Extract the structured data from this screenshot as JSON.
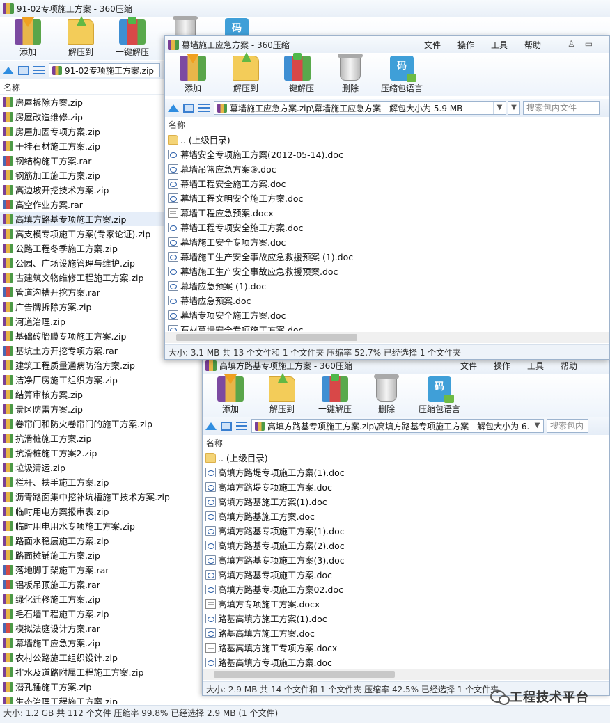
{
  "main": {
    "title": "91-02专项施工方案 - 360压缩",
    "toolbar": [
      "添加",
      "解压到",
      "一键解压"
    ],
    "code_badge": "码",
    "path": "91-02专项施工方案.zip",
    "column_name": "名称",
    "files": [
      {
        "name": "房屋拆除方案.zip",
        "type": "zip"
      },
      {
        "name": "房屋改造维修.zip",
        "type": "zip"
      },
      {
        "name": "房屋加固专项方案.zip",
        "type": "zip"
      },
      {
        "name": "干挂石材施工方案.zip",
        "type": "zip"
      },
      {
        "name": "钢结构施工方案.rar",
        "type": "rar"
      },
      {
        "name": "钢筋加工施工方案.zip",
        "type": "zip"
      },
      {
        "name": "高边坡开挖技术方案.zip",
        "type": "zip"
      },
      {
        "name": "高空作业方案.rar",
        "type": "rar"
      },
      {
        "name": "高填方路基专项施工方案.zip",
        "type": "zip",
        "selected": true
      },
      {
        "name": "高支模专项施工方案(专家论证).zip",
        "type": "zip"
      },
      {
        "name": "公路工程冬季施工方案.zip",
        "type": "zip"
      },
      {
        "name": "公园、广场设施管理与维护.zip",
        "type": "zip"
      },
      {
        "name": "古建筑文物维修工程施工方案.zip",
        "type": "zip"
      },
      {
        "name": "管道沟槽开挖方案.rar",
        "type": "rar"
      },
      {
        "name": "广告牌拆除方案.zip",
        "type": "zip"
      },
      {
        "name": "河道治理.zip",
        "type": "zip"
      },
      {
        "name": "基础砖胎膜专项施工方案.zip",
        "type": "zip"
      },
      {
        "name": "基坑土方开挖专项方案.rar",
        "type": "rar"
      },
      {
        "name": "建筑工程质量通病防治方案.zip",
        "type": "zip"
      },
      {
        "name": "洁净厂房施工组织方案.zip",
        "type": "zip"
      },
      {
        "name": "结算审核方案.zip",
        "type": "zip"
      },
      {
        "name": "景区防雷方案.zip",
        "type": "zip"
      },
      {
        "name": "卷帘门和防火卷帘门的施工方案.zip",
        "type": "zip"
      },
      {
        "name": "抗滑桩施工方案.zip",
        "type": "zip"
      },
      {
        "name": "抗滑桩施工方案2.zip",
        "type": "zip"
      },
      {
        "name": "垃圾清运.zip",
        "type": "zip"
      },
      {
        "name": "栏杆、扶手施工方案.zip",
        "type": "zip"
      },
      {
        "name": "沥青路面集中挖补坑槽施工技术方案.zip",
        "type": "zip"
      },
      {
        "name": "临时用电方案报审表.zip",
        "type": "zip"
      },
      {
        "name": "临时用电用水专项施工方案.zip",
        "type": "zip"
      },
      {
        "name": "路面水稳层施工方案.zip",
        "type": "zip"
      },
      {
        "name": "路面摊铺施工方案.zip",
        "type": "zip"
      },
      {
        "name": "落地脚手架施工方案.rar",
        "type": "rar"
      },
      {
        "name": "铝板吊顶施工方案.rar",
        "type": "rar"
      },
      {
        "name": "绿化迁移施工方案.zip",
        "type": "zip"
      },
      {
        "name": "毛石墙工程施工方案.zip",
        "type": "zip"
      },
      {
        "name": "模拟法庭设计方案.rar",
        "type": "rar"
      },
      {
        "name": "幕墙施工应急方案.zip",
        "type": "zip"
      },
      {
        "name": "农村公路施工组织设计.zip",
        "type": "zip"
      },
      {
        "name": "排水及道路附属工程施工方案.zip",
        "type": "zip"
      },
      {
        "name": "潜孔锤施工方案.zip",
        "type": "zip"
      },
      {
        "name": "生态治理工程施工方案.zip",
        "type": "zip"
      }
    ],
    "status": "大小: 1.2 GB 共 112 个文件 压缩率 99.8% 已经选择 2.9 MB (1 个文件)"
  },
  "window_a": {
    "title": "幕墙施工应急方案 - 360压缩",
    "menus": [
      "文件",
      "操作",
      "工具",
      "帮助"
    ],
    "toolbar": [
      "添加",
      "解压到",
      "一键解压",
      "删除",
      "压缩包语言"
    ],
    "code_badge": "码",
    "path": "幕墙施工应急方案.zip\\幕墙施工应急方案 - 解包大小为 5.9 MB",
    "search_placeholder": "搜索包内文件",
    "column_name": "名称",
    "files": [
      {
        "name": ".. (上级目录)",
        "type": "folder"
      },
      {
        "name": "幕墙安全专项施工方案(2012-05-14).doc",
        "type": "doc"
      },
      {
        "name": "幕墙吊篮应急方案③.doc",
        "type": "doc"
      },
      {
        "name": "幕墙工程安全施工方案.doc",
        "type": "doc"
      },
      {
        "name": "幕墙工程文明安全施工方案.doc",
        "type": "doc"
      },
      {
        "name": "幕墙工程应急预案.docx",
        "type": "docx"
      },
      {
        "name": "幕墙工程专项安全施工方案.doc",
        "type": "doc"
      },
      {
        "name": "幕墙施工安全专项方案.doc",
        "type": "doc"
      },
      {
        "name": "幕墙施工生产安全事故应急救援预案 (1).doc",
        "type": "doc"
      },
      {
        "name": "幕墙施工生产安全事故应急救援预案.doc",
        "type": "doc"
      },
      {
        "name": "幕墙应急预案 (1).doc",
        "type": "doc"
      },
      {
        "name": "幕墙应急预案.doc",
        "type": "doc"
      },
      {
        "name": "幕墙专项安全施工方案.doc",
        "type": "doc"
      },
      {
        "name": "石材幕墙安全专项施工方案.doc",
        "type": "doc"
      }
    ],
    "status": "大小: 3.1 MB 共 13 个文件和 1 个文件夹 压缩率 52.7% 已经选择 1 个文件夹"
  },
  "window_b": {
    "title": "高填方路基专项施工方案 - 360压缩",
    "menus": [
      "文件",
      "操作",
      "工具",
      "帮助"
    ],
    "toolbar": [
      "添加",
      "解压到",
      "一键解压",
      "删除",
      "压缩包语言"
    ],
    "code_badge": "码",
    "path": "高填方路基专项施工方案.zip\\高填方路基专项施工方案 - 解包大小为 6.",
    "search_placeholder": "搜索包内",
    "column_name": "名称",
    "files": [
      {
        "name": ".. (上级目录)",
        "type": "folder"
      },
      {
        "name": "高填方路堤专项施工方案(1).doc",
        "type": "doc"
      },
      {
        "name": "高填方路堤专项施工方案.doc",
        "type": "doc"
      },
      {
        "name": "高填方路基施工方案(1).doc",
        "type": "doc"
      },
      {
        "name": "高填方路基施工方案.doc",
        "type": "doc"
      },
      {
        "name": "高填方路基专项施工方案(1).doc",
        "type": "doc"
      },
      {
        "name": "高填方路基专项施工方案(2).doc",
        "type": "doc"
      },
      {
        "name": "高填方路基专项施工方案(3).doc",
        "type": "doc"
      },
      {
        "name": "高填方路基专项施工方案.doc",
        "type": "doc"
      },
      {
        "name": "高填方路基专项施工方案02.doc",
        "type": "doc"
      },
      {
        "name": "高填方专项施工方案.docx",
        "type": "docx"
      },
      {
        "name": "路基高填方施工方案(1).doc",
        "type": "doc"
      },
      {
        "name": "路基高填方施工方案.doc",
        "type": "doc"
      },
      {
        "name": "路基高填方施工专项方案.docx",
        "type": "docx"
      },
      {
        "name": "路基高填方专项施工方案.doc",
        "type": "doc"
      }
    ],
    "status": "大小: 2.9 MB 共 14 个文件和 1 个文件夹 压缩率 42.5% 已经选择 1 个文件夹"
  },
  "watermark": "工程技术平台"
}
